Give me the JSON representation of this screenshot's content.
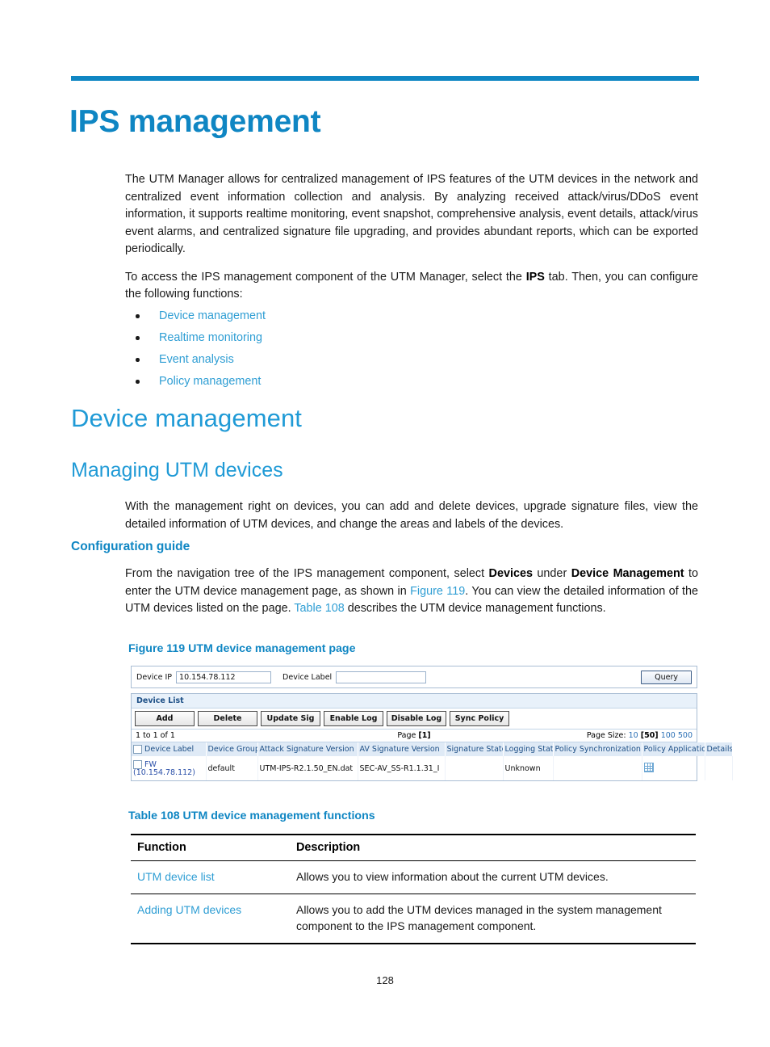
{
  "chapter": {
    "title": "IPS management",
    "accent_color": "#0f86c3"
  },
  "intro": {
    "paragraph1": "The UTM Manager allows for centralized management of IPS features of the UTM devices in the network and centralized event information collection and analysis. By analyzing received attack/virus/DDoS event information, it supports realtime monitoring, event snapshot, comprehensive analysis, event details, attack/virus event alarms, and centralized signature file upgrading, and provides abundant reports, which can be exported periodically.",
    "paragraph2_part1": "To access the IPS management component of the UTM Manager, select the ",
    "paragraph2_bold": "IPS",
    "paragraph2_part2": " tab. Then, you can configure the following functions:",
    "bullets": [
      {
        "label": "Device management"
      },
      {
        "label": "Realtime monitoring"
      },
      {
        "label": "Event analysis"
      },
      {
        "label": "Policy management"
      }
    ]
  },
  "sections": {
    "device_management": "Device management",
    "managing_utm_devices": "Managing UTM devices",
    "managing_intro": "With the management right on devices, you can add and delete devices, upgrade signature files, view the detailed information of UTM devices, and change the areas and labels of the devices.",
    "configuration_guide": "Configuration guide",
    "config_part1": "From the navigation tree of the IPS management component, select ",
    "config_bold1": "Devices",
    "config_part2": " under ",
    "config_bold2": "Device Management",
    "config_part3": " to enter the UTM device management page, as shown in ",
    "config_link1": "Figure 119",
    "config_part4": ". You can view the detailed information of the UTM devices listed on the page. ",
    "config_link2": "Table 108",
    "config_part5": " describes the UTM device management functions."
  },
  "figure": {
    "caption": "Figure 119 UTM device management page"
  },
  "screenshot": {
    "query_bar": {
      "device_ip_label": "Device IP",
      "device_ip_value": "10.154.78.112",
      "device_label_label": "Device Label",
      "device_label_value": "",
      "query_button": "Query"
    },
    "panel_title": "Device List",
    "toolbar": [
      {
        "label": "Add"
      },
      {
        "label": "Delete"
      },
      {
        "label": "Update Sig"
      },
      {
        "label": "Enable Log"
      },
      {
        "label": "Disable Log"
      },
      {
        "label": "Sync Policy"
      }
    ],
    "pager": {
      "range": "1 to 1 of 1",
      "page_label": "Page",
      "page_current": "[1]",
      "page_size_label": "Page Size:",
      "page_size_options": [
        "10",
        "100",
        "500"
      ],
      "page_size_10": "10",
      "page_size_current": "[50]",
      "page_size_100": "100",
      "page_size_500": "500"
    },
    "columns": [
      "Device Label",
      "Device Group",
      "Attack Signature Version",
      "AV Signature Version",
      "Signature State",
      "Logging State",
      "Policy Synchronization",
      "Policy Application",
      "Details"
    ],
    "rows": [
      {
        "device_label_line1": "FW",
        "device_label_line2": "(10.154.78.112)",
        "device_group": "default",
        "attack_signature_version": "UTM-IPS-R2.1.50_EN.dat",
        "av_signature_version": "SEC-AV_SS-R1.1.31_I",
        "signature_state": "",
        "logging_state": "Unknown",
        "policy_synchronization": "",
        "policy_application": "",
        "details_icon": "grid-icon"
      }
    ]
  },
  "functions_table": {
    "caption": "Table 108 UTM device management functions",
    "headers": [
      "Function",
      "Description"
    ],
    "rows": [
      {
        "function": "UTM device list",
        "description": "Allows you to view information about the current UTM devices."
      },
      {
        "function": "Adding UTM devices",
        "description": "Allows you to add the UTM devices managed in the system management component to the IPS management component."
      }
    ]
  },
  "footer": {
    "page_number": "128"
  }
}
